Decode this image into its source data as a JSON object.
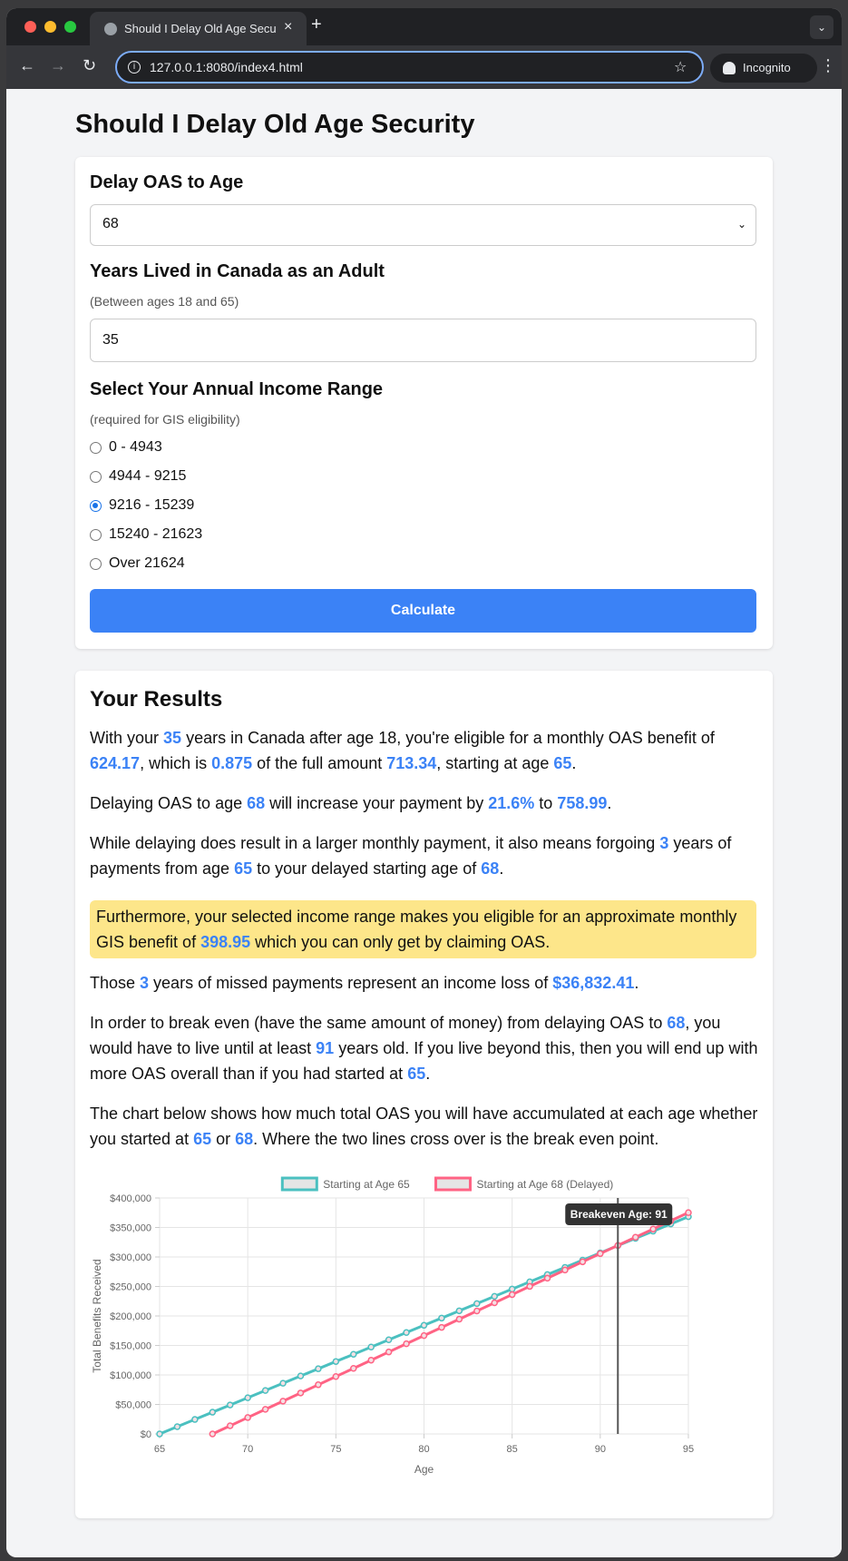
{
  "browser": {
    "tab_title": "Should I Delay Old Age Securi",
    "url": "127.0.0.1:8080/index4.html",
    "incognito_label": "Incognito"
  },
  "page": {
    "title": "Should I Delay Old Age Security"
  },
  "form": {
    "delay_label": "Delay OAS to Age",
    "delay_value": "68",
    "years_label": "Years Lived in Canada as an Adult",
    "years_hint": "(Between ages 18 and 65)",
    "years_value": "35",
    "income_label": "Select Your Annual Income Range",
    "income_hint": "(required for GIS eligibility)",
    "income_options": [
      {
        "label": "0 - 4943",
        "selected": false
      },
      {
        "label": "4944 - 9215",
        "selected": false
      },
      {
        "label": "9216 - 15239",
        "selected": true
      },
      {
        "label": "15240 - 21623",
        "selected": false
      },
      {
        "label": "Over 21624",
        "selected": false
      }
    ],
    "calculate_label": "Calculate"
  },
  "results": {
    "title": "Your Results",
    "p1": {
      "t1": "With your ",
      "years": "35",
      "t2": " years in Canada after age 18, you're eligible for a monthly OAS benefit of ",
      "monthly": "624.17",
      "t3": ", which is ",
      "fraction": "0.875",
      "t4": " of the full amount ",
      "full": "713.34",
      "t5": ", starting at age ",
      "start_age": "65",
      "t6": "."
    },
    "p2": {
      "t1": "Delaying OAS to age ",
      "delay_age": "68",
      "t2": " will increase your payment by ",
      "pct": "21.6%",
      "t3": " to ",
      "new_amount": "758.99",
      "t4": "."
    },
    "p3": {
      "t1": "While delaying does result in a larger monthly payment, it also means forgoing ",
      "years": "3",
      "t2": " years of payments from age ",
      "start_age": "65",
      "t3": " to your delayed starting age of ",
      "delay_age": "68",
      "t4": "."
    },
    "notice": {
      "t1": "Furthermore, your selected income range makes you eligible for an approximate monthly GIS benefit of ",
      "gis": "398.95",
      "t2": " which you can only get by claiming OAS."
    },
    "p4": {
      "t1": "Those ",
      "years": "3",
      "t2": " years of missed payments represent an income loss of ",
      "loss": "$36,832.41",
      "t3": "."
    },
    "p5": {
      "t1": "In order to break even (have the same amount of money) from delaying OAS to ",
      "delay_age": "68",
      "t2": ", you would have to live until at least ",
      "breakeven": "91",
      "t3": " years old. If you live beyond this, then you will end up with more OAS overall than if you had started at ",
      "start_age": "65",
      "t4": "."
    },
    "p6": {
      "t1": "The chart below shows how much total OAS you will have accumulated at each age whether you started at ",
      "a": "65",
      "t2": " or ",
      "b": "68",
      "t3": ". Where the two lines cross over is the break even point."
    }
  },
  "chart_data": {
    "type": "line",
    "xlabel": "Age",
    "ylabel": "Total Benefits Received",
    "xlim": [
      65,
      95
    ],
    "ylim": [
      0,
      400000
    ],
    "x_ticks": [
      "65",
      "70",
      "75",
      "80",
      "85",
      "90",
      "95"
    ],
    "y_ticks": [
      "$0",
      "$50,000",
      "$100,000",
      "$150,000",
      "$200,000",
      "$250,000",
      "$300,000",
      "$350,000",
      "$400,000"
    ],
    "legend_position": "top",
    "grid": true,
    "series": [
      {
        "name": "Starting at Age 65",
        "color": "#4bc0c0",
        "x": [
          65,
          66,
          67,
          68,
          69,
          70,
          71,
          72,
          73,
          74,
          75,
          76,
          77,
          78,
          79,
          80,
          81,
          82,
          83,
          84,
          85,
          86,
          87,
          88,
          89,
          90,
          91,
          92,
          93,
          94,
          95
        ],
        "values": [
          0,
          12277,
          24554,
          36832,
          49109,
          61386,
          73663,
          85940,
          98218,
          110495,
          122772,
          135049,
          147326,
          159604,
          171881,
          184158,
          196435,
          208712,
          220990,
          233267,
          245544,
          257821,
          270098,
          282376,
          294653,
          306930,
          319207,
          331484,
          343762,
          356039,
          368316
        ]
      },
      {
        "name": "Starting at Age 68 (Delayed)",
        "color": "#ff6384",
        "x": [
          68,
          69,
          70,
          71,
          72,
          73,
          74,
          75,
          76,
          77,
          78,
          79,
          80,
          81,
          82,
          83,
          84,
          85,
          86,
          87,
          88,
          89,
          90,
          91,
          92,
          93,
          94,
          95
        ],
        "values": [
          0,
          13896,
          27792,
          41688,
          55584,
          69480,
          83376,
          97272,
          111168,
          125064,
          138960,
          152856,
          166752,
          180648,
          194544,
          208440,
          222336,
          236232,
          250128,
          264024,
          277920,
          291816,
          305712,
          319608,
          333504,
          347400,
          361296,
          375192
        ]
      }
    ],
    "annotation": {
      "label": "Breakeven Age: 91",
      "x": 91,
      "color": "#555555"
    }
  }
}
